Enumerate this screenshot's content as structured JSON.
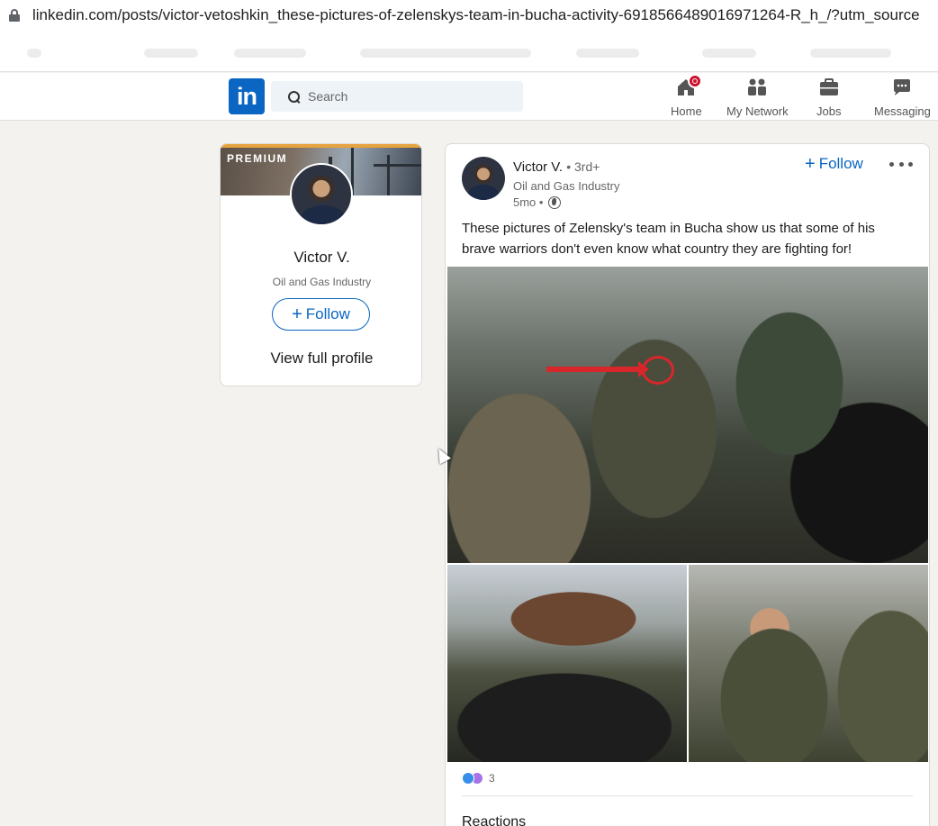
{
  "browser": {
    "url": "linkedin.com/posts/victor-vetoshkin_these-pictures-of-zelenskys-team-in-bucha-activity-6918566489016971264-R_h_/?utm_source"
  },
  "nav": {
    "logo_text": "in",
    "search_placeholder": "Search",
    "items": [
      {
        "label": "Home",
        "icon": "home-icon"
      },
      {
        "label": "My Network",
        "icon": "network-icon"
      },
      {
        "label": "Jobs",
        "icon": "briefcase-icon"
      },
      {
        "label": "Messaging",
        "icon": "chat-icon"
      }
    ],
    "brand_color": "#0a66c2",
    "badge_color": "#cb112d"
  },
  "profile_card": {
    "badge": "PREMIUM",
    "name": "Victor V.",
    "headline": "Oil and Gas Industry",
    "follow_label": "Follow",
    "view_profile_label": "View full profile"
  },
  "post": {
    "author_name": "Victor V.",
    "degree": "• 3rd+",
    "author_headline": "Oil and Gas Industry",
    "time": "5mo •",
    "follow_label": "Follow",
    "text": "These pictures of Zelensky's team in Bucha show us that some of his brave warriors don't even know what country they are fighting for!",
    "reaction_count": "3",
    "reactions_heading": "Reactions",
    "annotation_color": "#d8262b"
  }
}
